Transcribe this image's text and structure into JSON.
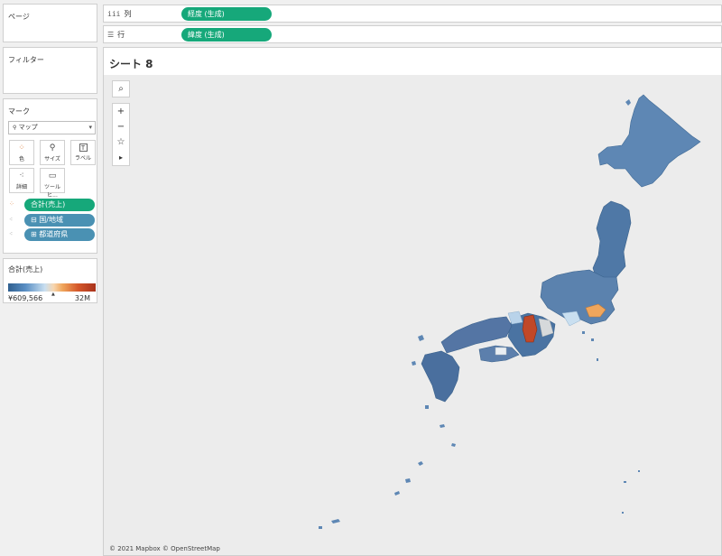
{
  "sidebar": {
    "pages": {
      "title": "ページ"
    },
    "filters": {
      "title": "フィルター"
    },
    "marks": {
      "title": "マーク",
      "type": "マップ",
      "type_icon": "map-icon",
      "buttons": [
        {
          "label": "色",
          "icon": "color-dots-icon"
        },
        {
          "label": "サイズ",
          "icon": "size-icon"
        },
        {
          "label": "ラベル",
          "icon": "label-icon"
        },
        {
          "label": "詳細",
          "icon": "detail-icon"
        },
        {
          "label": "ツールヒ...",
          "icon": "tooltip-icon"
        }
      ],
      "pills": [
        {
          "label": "合計(売上)",
          "kind": "color"
        },
        {
          "label": "⊟ 国/地域",
          "kind": "detail"
        },
        {
          "label": "⊞ 都道府県",
          "kind": "detail"
        }
      ]
    },
    "legend": {
      "title": "合計(売上)",
      "min": "¥609,566",
      "max": "32M"
    }
  },
  "shelves": {
    "columns": {
      "label": "列",
      "pill": "経度 (生成)"
    },
    "rows": {
      "label": "行",
      "pill": "緯度 (生成)"
    }
  },
  "sheet": {
    "title": "シート 8",
    "credit": "© 2021 Mapbox © OpenStreetMap",
    "tools": [
      "search-icon",
      "zoom-in-icon",
      "zoom-out-icon",
      "pin-icon",
      "play-icon"
    ]
  },
  "colors": {
    "accent_green": "#16a87a",
    "pill_blue": "#4a91b3",
    "map_low": "#2f5f8f",
    "map_mid": "#5e87b4",
    "map_high": "#a8321c",
    "map_orange": "#f0a65c"
  }
}
